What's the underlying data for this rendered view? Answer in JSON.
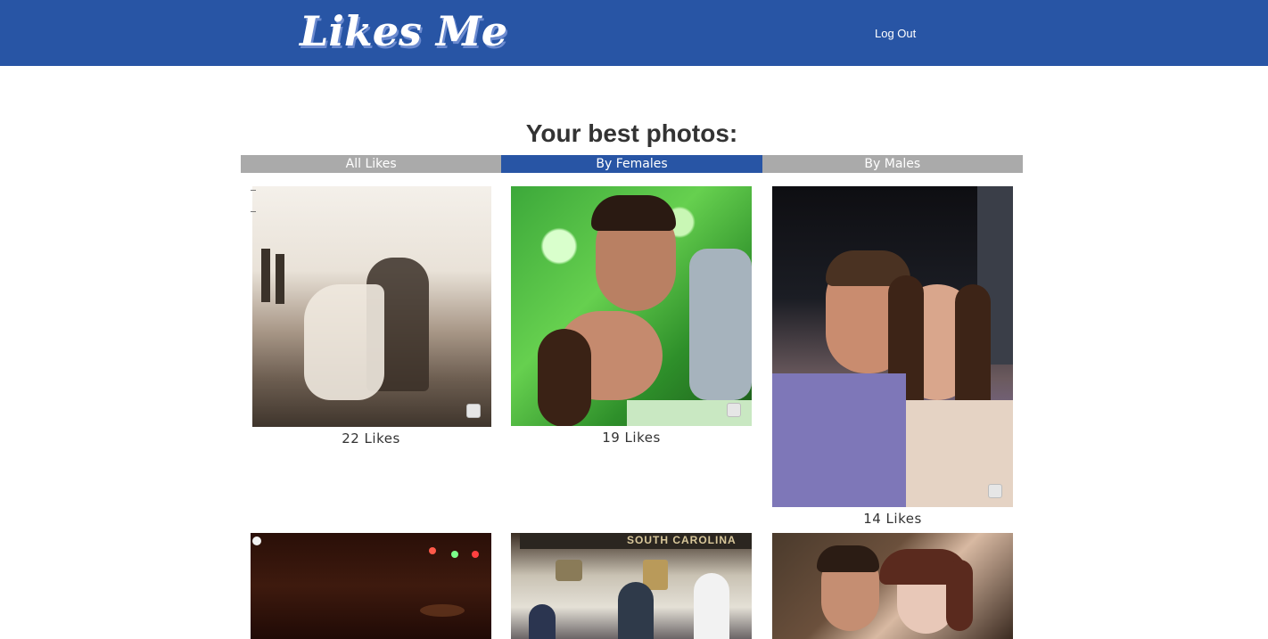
{
  "header": {
    "logo_text": "Likes Me",
    "logout_label": "Log Out",
    "brand_color": "#2855a5"
  },
  "main": {
    "title": "Your best photos:",
    "tabs": [
      {
        "label": "All Likes",
        "active": false
      },
      {
        "label": "By Females",
        "active": true
      },
      {
        "label": "By Males",
        "active": false
      }
    ],
    "photos": [
      {
        "likes": "22 Likes",
        "description": "sepia couple dancing kiss on boardwalk"
      },
      {
        "likes": "19 Likes",
        "description": "couple gazing at each other, green foliage"
      },
      {
        "likes": "14 Likes",
        "description": "couple selfie at night"
      },
      {
        "likes": "",
        "description": "dark room with colored lights"
      },
      {
        "likes": "",
        "description": "couple dancing with band, South Carolina sign"
      },
      {
        "likes": "",
        "description": "couple close portrait outdoors"
      }
    ],
    "signage_text": "SOUTH CAROLINA"
  },
  "colors": {
    "tab_inactive": "#aaaaaa",
    "tab_active": "#2855a5",
    "text": "#333333"
  }
}
